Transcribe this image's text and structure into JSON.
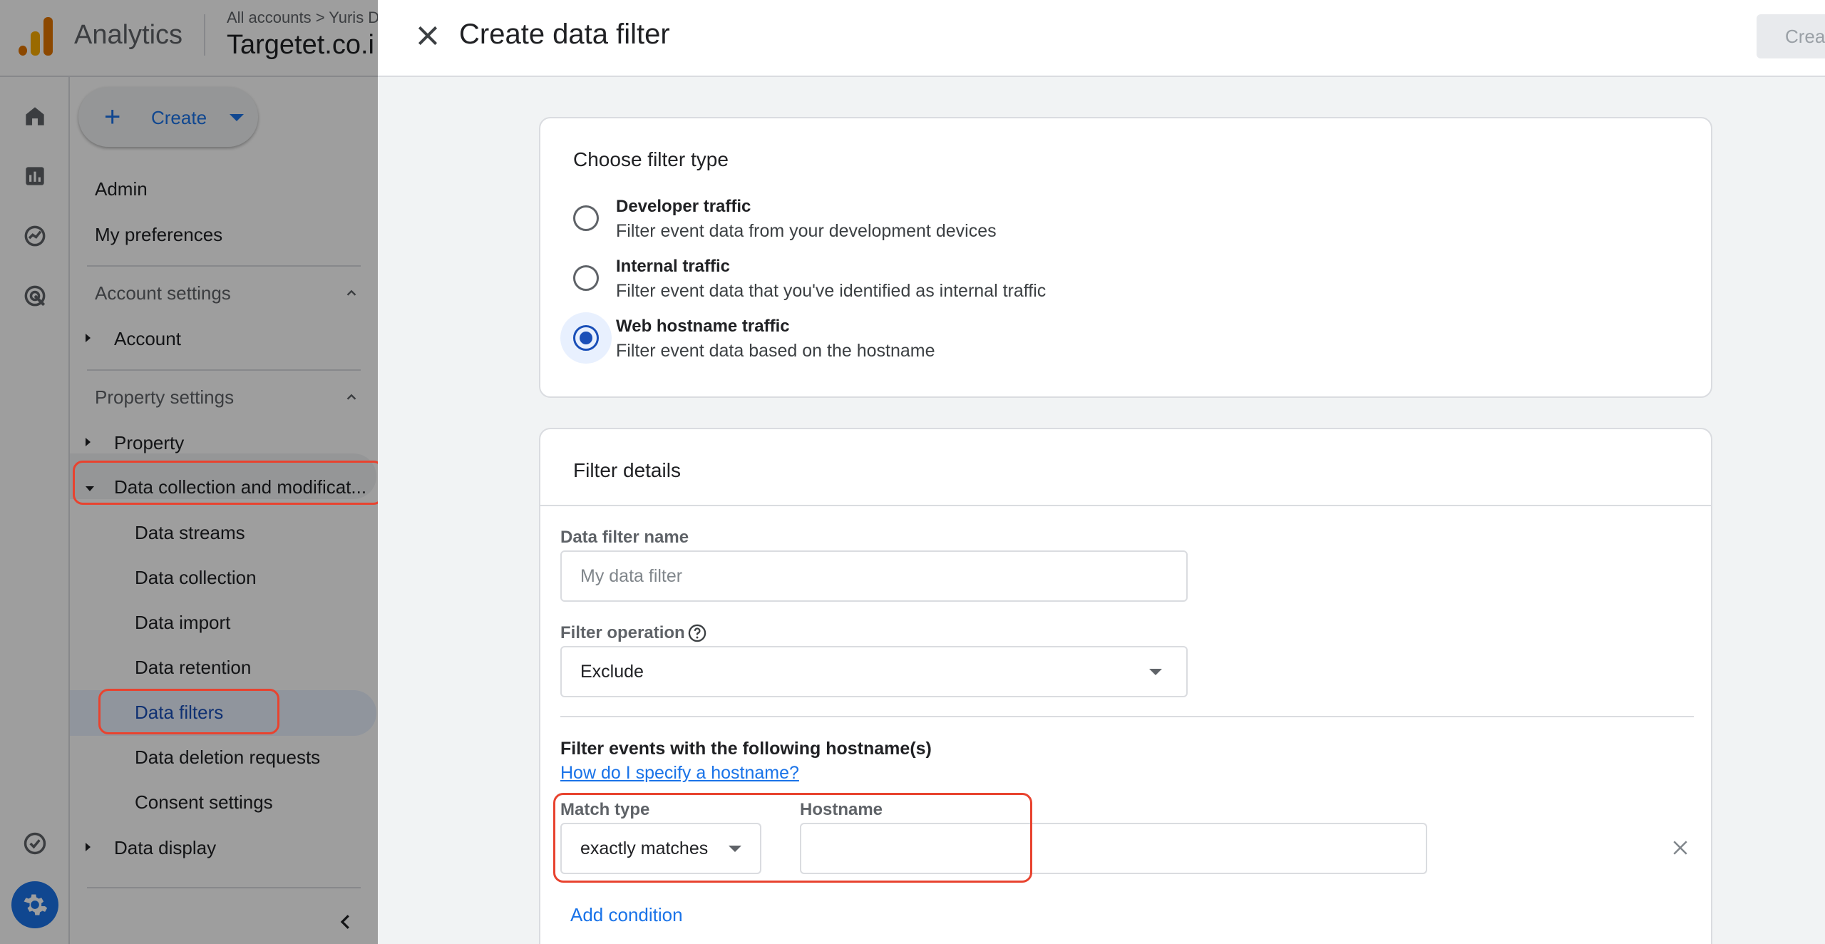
{
  "app": {
    "name": "Analytics",
    "breadcrumb": "All accounts > Yuris D",
    "property": "Targetet.co.i"
  },
  "nav": {
    "create_label": "Create",
    "admin": "Admin",
    "preferences": "My preferences",
    "account_settings": "Account settings",
    "account": "Account",
    "property_settings": "Property settings",
    "property": "Property",
    "data_collection_mod": "Data collection and modificat...",
    "sub_items": [
      "Data streams",
      "Data collection",
      "Data import",
      "Data retention",
      "Data filters",
      "Data deletion requests",
      "Consent settings"
    ],
    "data_display": "Data display",
    "active_item": "Data filters"
  },
  "dialog": {
    "title": "Create data filter",
    "submit_label": "Crea",
    "filter_type": {
      "heading": "Choose filter type",
      "options": [
        {
          "title": "Developer traffic",
          "desc": "Filter event data from your development devices",
          "selected": false
        },
        {
          "title": "Internal traffic",
          "desc": "Filter event data that you've identified as internal traffic",
          "selected": false
        },
        {
          "title": "Web hostname traffic",
          "desc": "Filter event data based on the hostname",
          "selected": true
        }
      ]
    },
    "details": {
      "heading": "Filter details",
      "name_label": "Data filter name",
      "name_placeholder": "My data filter",
      "operation_label": "Filter operation",
      "operation_value": "Exclude",
      "hostnames_heading": "Filter events with the following hostname(s)",
      "help_link": "How do I specify a hostname?",
      "match_type_label": "Match type",
      "match_type_value": "exactly matches",
      "hostname_label": "Hostname",
      "hostname_value": "",
      "add_condition": "Add condition"
    }
  },
  "colors": {
    "accent": "#1a73e8",
    "annotation": "#e8432f",
    "selected_radio": "#1a4fb8"
  }
}
